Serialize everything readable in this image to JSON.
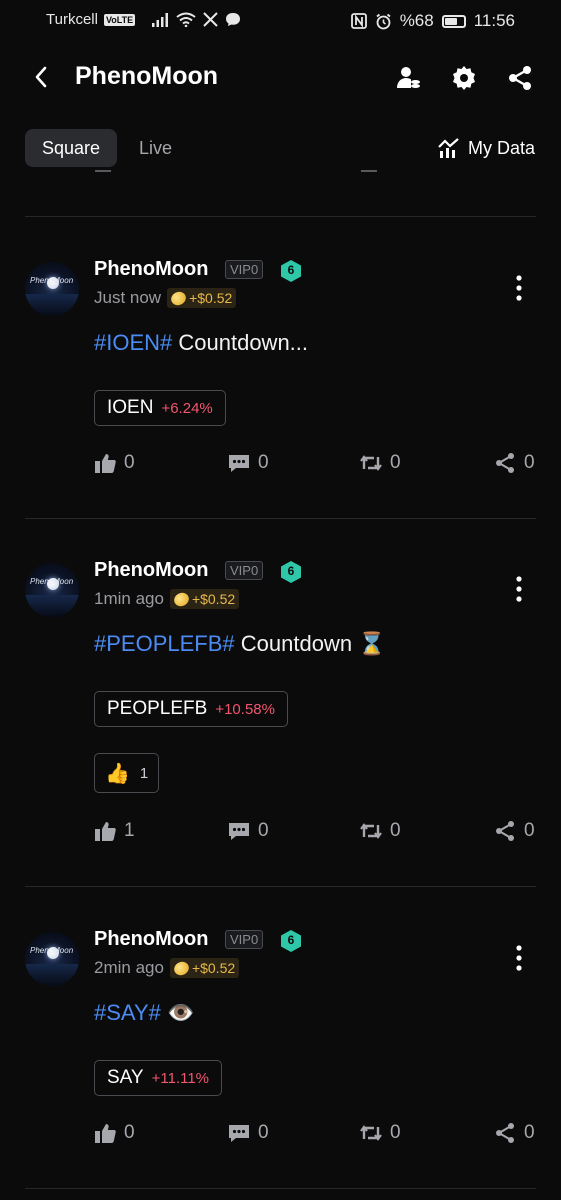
{
  "status_bar": {
    "carrier": "Turkcell",
    "volte": "VoLTE",
    "battery": "%68",
    "battery_level": 0.68,
    "time": "11:56"
  },
  "app": {
    "title": "PhenoMoon"
  },
  "tabs": [
    {
      "label": "Square",
      "active": true
    },
    {
      "label": "Live",
      "active": false
    }
  ],
  "my_data_label": "My Data",
  "posts": [
    {
      "author": "PhenoMoon",
      "vip": "VIP0",
      "level": "6",
      "time": "Just now",
      "tip": "+$0.52",
      "hashtag": "#IOEN#",
      "text": " Countdown...",
      "emoji": "",
      "ticker": {
        "symbol": "IOEN",
        "change": "+6.24%"
      },
      "reaction": null,
      "likes": "0",
      "comments": "0",
      "reposts": "0",
      "shares": "0"
    },
    {
      "author": "PhenoMoon",
      "vip": "VIP0",
      "level": "6",
      "time": "1min ago",
      "tip": "+$0.52",
      "hashtag": "#PEOPLEFB#",
      "text": " Countdown ",
      "emoji": "⌛",
      "ticker": {
        "symbol": "PEOPLEFB",
        "change": "+10.58%"
      },
      "reaction": {
        "emoji": "👍",
        "count": "1"
      },
      "likes": "1",
      "comments": "0",
      "reposts": "0",
      "shares": "0"
    },
    {
      "author": "PhenoMoon",
      "vip": "VIP0",
      "level": "6",
      "time": "2min ago",
      "tip": "+$0.52",
      "hashtag": "#SAY#",
      "text": " ",
      "emoji": "👁️",
      "ticker": {
        "symbol": "SAY",
        "change": "+11.11%"
      },
      "reaction": null,
      "likes": "0",
      "comments": "0",
      "reposts": "0",
      "shares": "0"
    }
  ],
  "colors": {
    "background": "#0b0b0c",
    "hashtag": "#4a8cf3",
    "positive_change": "#f0566e",
    "level_badge": "#2ec8a8",
    "tip": "#e7b84a"
  }
}
